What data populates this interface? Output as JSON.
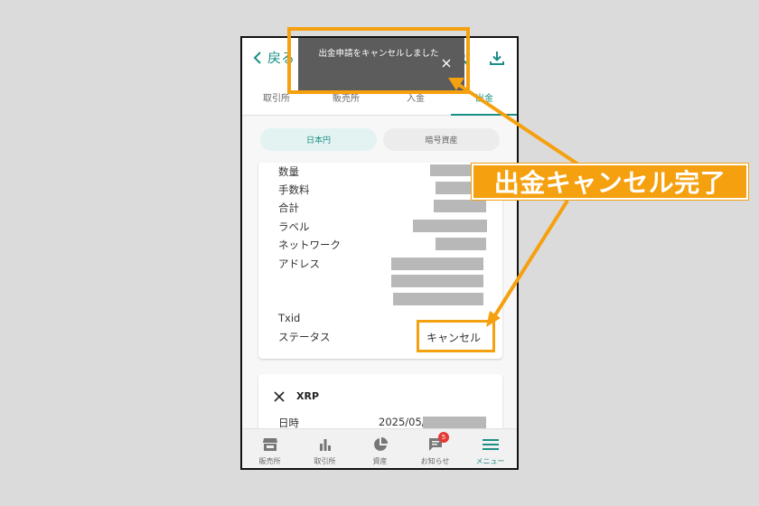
{
  "header": {
    "back_label": "戻る"
  },
  "tabs": [
    {
      "label": "取引所"
    },
    {
      "label": "販売所"
    },
    {
      "label": "入金"
    },
    {
      "label": "出金"
    }
  ],
  "segments": [
    {
      "label": "日本円"
    },
    {
      "label": "暗号資産"
    }
  ],
  "detail": {
    "rows": [
      {
        "label": "数量"
      },
      {
        "label": "手数料"
      },
      {
        "label": "合計"
      },
      {
        "label": "ラベル"
      },
      {
        "label": "ネットワーク"
      },
      {
        "label": "アドレス"
      },
      {
        "label": "Txid"
      },
      {
        "label": "ステータス"
      }
    ],
    "status_value": "キャンセル"
  },
  "card2": {
    "asset": "XRP",
    "date_label": "日時",
    "date_value": "2025/05/"
  },
  "toast": {
    "message": "出金申請をキャンセルしました"
  },
  "bottom_nav": [
    {
      "label": "販売所"
    },
    {
      "label": "取引所"
    },
    {
      "label": "資産"
    },
    {
      "label": "お知らせ",
      "badge": "5"
    },
    {
      "label": "メニュー"
    }
  ],
  "annotation": {
    "callout_text": "出金キャンセル完了",
    "color": "#f5a00f"
  },
  "colors": {
    "accent": "#1a8f85",
    "toast_bg": "#5c5c5c",
    "badge": "#e53935"
  }
}
